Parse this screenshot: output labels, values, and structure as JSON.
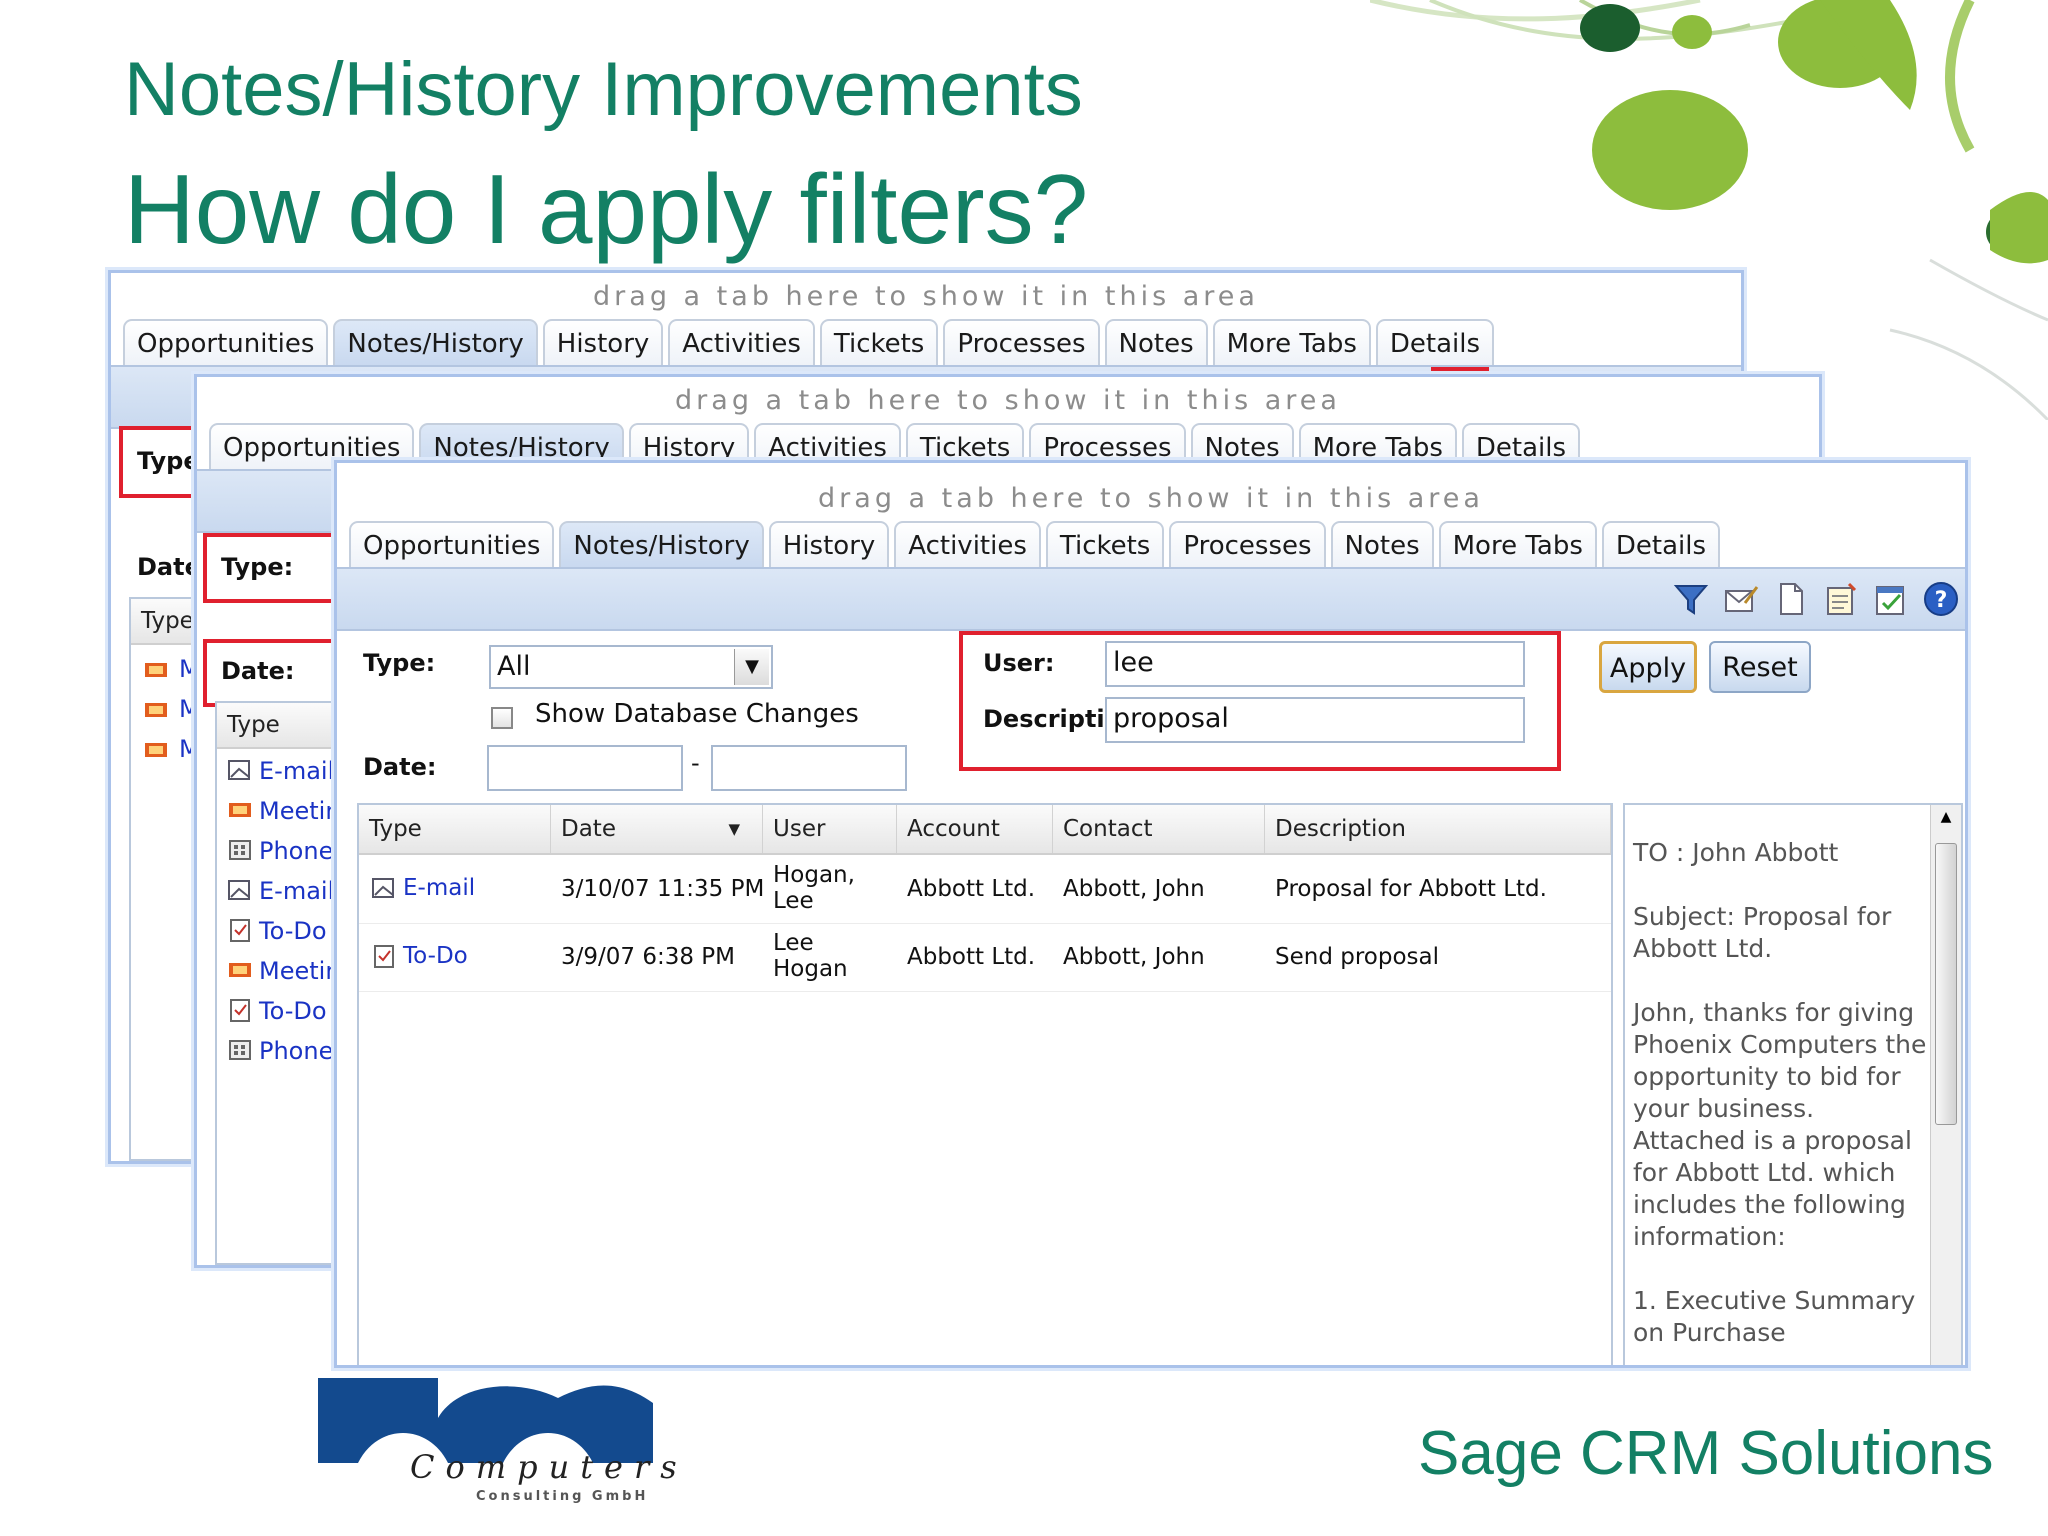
{
  "slide": {
    "heading": "Notes/History Improvements",
    "question": "How do I apply filters?"
  },
  "tabs": [
    "Opportunities",
    "Notes/History",
    "History",
    "Activities",
    "Tickets",
    "Processes",
    "Notes",
    "More Tabs",
    "Details"
  ],
  "drag_hint": "drag a tab here to show it in this area",
  "back_window": {
    "type_label": "Type:",
    "date_label": "Date:",
    "col_type": "Type",
    "row_prefix": "M"
  },
  "middle_window": {
    "type_label": "Type:",
    "date_label": "Date:",
    "col_type": "Type",
    "rows": [
      "E-mail",
      "Meetin",
      "Phone",
      "E-mail",
      "To-Do",
      "Meetin",
      "To-Do",
      "Phone"
    ]
  },
  "filters": {
    "type_label": "Type:",
    "type_value": "All",
    "show_db_changes_label": "Show Database Changes",
    "date_label": "Date:",
    "date_separator": "-",
    "user_label": "User:",
    "user_value": "lee",
    "description_label": "Descriptio",
    "description_value": "proposal",
    "apply_label": "Apply",
    "reset_label": "Reset"
  },
  "grid": {
    "columns": [
      "Type",
      "Date",
      "User",
      "Account",
      "Contact",
      "Description"
    ],
    "rows": [
      {
        "type": "E-mail",
        "date": "3/10/07 11:35 PM",
        "user_line1": "Hogan,",
        "user_line2": "Lee",
        "account": "Abbott Ltd.",
        "contact": "Abbott, John",
        "description": "Proposal for Abbott Ltd."
      },
      {
        "type": "To-Do",
        "date": "3/9/07 6:38 PM",
        "user_line1": "Lee",
        "user_line2": "Hogan",
        "account": "Abbott Ltd.",
        "contact": "Abbott, John",
        "description": "Send proposal"
      }
    ]
  },
  "preview": {
    "to": "TO : John Abbott",
    "subject_1": "Subject: Proposal for",
    "subject_2": "Abbott Ltd.",
    "body": [
      "John, thanks for giving",
      "Phoenix Computers the",
      "opportunity to bid for",
      "your business.",
      "Attached is a proposal",
      "for Abbott Ltd. which",
      "includes the following",
      "information:"
    ],
    "list_1": "1.  Executive Summary",
    "list_2": "on Purchase"
  },
  "footer": {
    "logo_word": "Computers",
    "logo_sub": "Consulting GmbH",
    "brand": "Sage CRM Solutions"
  },
  "colors": {
    "title_green": "#138064",
    "highlight_red": "#e0202e",
    "link_blue": "#1a33c4",
    "logo_blue": "#134a8e"
  }
}
